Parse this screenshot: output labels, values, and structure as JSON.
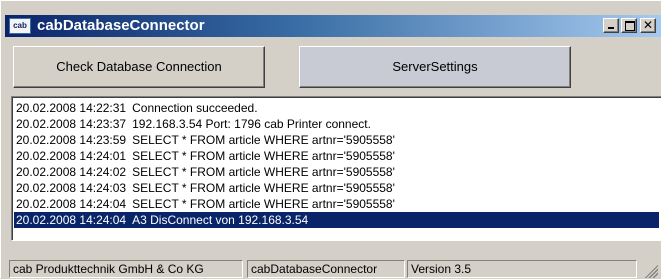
{
  "window": {
    "title": "cabDatabaseConnector",
    "icon_label": "cab",
    "controls": [
      "minimize-icon",
      "maximize-icon",
      "close-icon"
    ]
  },
  "buttons": {
    "check_db": "Check Database Connection",
    "server_settings": "ServerSettings"
  },
  "log": [
    {
      "time": "20.02.2008 14:22:31",
      "message": "Connection succeeded."
    },
    {
      "time": "20.02.2008 14:23:37",
      "message": "192.168.3.54 Port: 1796  cab Printer connect."
    },
    {
      "time": "20.02.2008 14:23:59",
      "message": "SELECT * FROM article WHERE artnr='5905558'"
    },
    {
      "time": "20.02.2008 14:24:01",
      "message": "SELECT * FROM article WHERE artnr='5905558'"
    },
    {
      "time": "20.02.2008 14:24:02",
      "message": "SELECT * FROM article WHERE artnr='5905558'"
    },
    {
      "time": "20.02.2008 14:24:03",
      "message": "SELECT * FROM article WHERE artnr='5905558'"
    },
    {
      "time": "20.02.2008 14:24:04",
      "message": "SELECT * FROM article WHERE artnr='5905558'"
    },
    {
      "time": "20.02.2008 14:24:04",
      "message": "A3 DisConnect von 192.168.3.54",
      "selected": true
    }
  ],
  "status": {
    "company": "cab Produkttechnik GmbH & Co KG",
    "app": "cabDatabaseConnector",
    "version": "Version 3.5"
  },
  "colors": {
    "titlebar_start": "#0a246a",
    "titlebar_end": "#a6caf0",
    "selection": "#0a246a",
    "face": "#d4d0c8"
  }
}
